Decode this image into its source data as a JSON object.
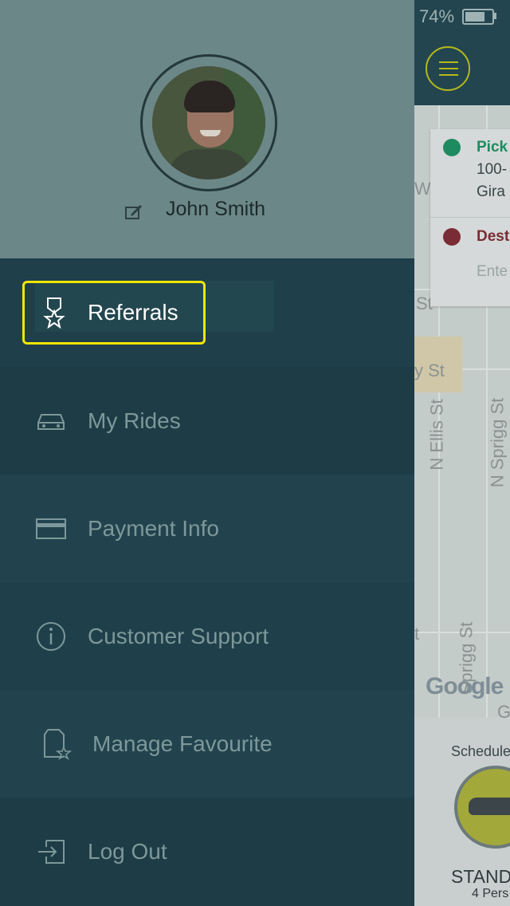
{
  "status_bar": {
    "battery_text": "74%"
  },
  "profile": {
    "name": "John Smith",
    "edit_icon": "edit-icon",
    "avatar_icon": "avatar"
  },
  "menu": {
    "items": [
      {
        "label": "Referrals",
        "icon": "award-icon",
        "active": true
      },
      {
        "label": "My Rides",
        "icon": "car-icon"
      },
      {
        "label": "Payment Info",
        "icon": "credit-card-icon"
      },
      {
        "label": "Customer Support",
        "icon": "info-icon"
      },
      {
        "label": "Manage Favourite",
        "icon": "favourite-document-icon"
      },
      {
        "label": "Log Out",
        "icon": "logout-icon"
      }
    ]
  },
  "background_map": {
    "pickup_label": "Pick",
    "pickup_line1": "100-",
    "pickup_line2": "Gira",
    "destination_label": "Dest",
    "destination_placeholder": "Ente",
    "streets": [
      "W",
      "St",
      "y St",
      "N Ellis St",
      "N Sprigg St",
      "Sprigg St",
      "t",
      "G"
    ],
    "google_logo": "Google",
    "schedule_label": "Schedule",
    "vehicle_name": "STAND",
    "vehicle_capacity": "4 Pers"
  },
  "colors": {
    "accent_highlight": "#f2e600",
    "drawer_bg": "#1f3f4a",
    "profile_bg": "#6c8788",
    "pickup_dot": "#1e8a60",
    "destination_dot": "#7a2c34"
  }
}
